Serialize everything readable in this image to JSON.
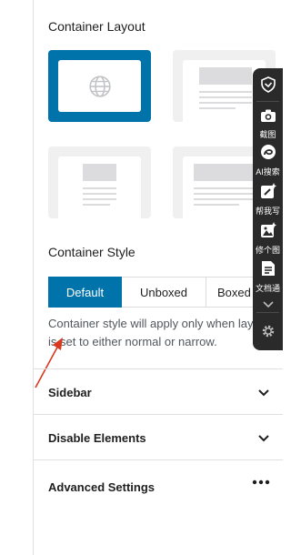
{
  "container_layout": {
    "title": "Container Layout",
    "options": [
      {
        "name": "full-width",
        "selected": true
      },
      {
        "name": "sidebar-right",
        "selected": false
      },
      {
        "name": "narrow",
        "selected": false
      },
      {
        "name": "normal",
        "selected": false
      }
    ]
  },
  "container_style": {
    "title": "Container Style",
    "buttons": [
      "Default",
      "Unboxed",
      "Boxed"
    ],
    "active": "Default",
    "help_line1": "Container style will apply only when lay",
    "help_line2": "is set to either normal or narrow."
  },
  "panels": [
    {
      "label": "Sidebar",
      "icon": "chevron-down-icon"
    },
    {
      "label": "Disable Elements",
      "icon": "chevron-down-icon"
    },
    {
      "label": "Advanced Settings",
      "icon": "more-dots-icon"
    }
  ],
  "toolbar": {
    "items": [
      {
        "icon": "shield-icon",
        "label": ""
      },
      {
        "icon": "camera-icon",
        "label": "截图"
      },
      {
        "icon": "ai-search-icon",
        "label": "AI搜索"
      },
      {
        "icon": "edit-sparkle-icon",
        "label": "帮我写"
      },
      {
        "icon": "image-edit-icon",
        "label": "修个图"
      },
      {
        "icon": "document-icon",
        "label": "文档通"
      },
      {
        "icon": "chevron-down-icon",
        "label": ""
      },
      {
        "icon": "gear-icon",
        "label": ""
      }
    ]
  },
  "colors": {
    "accent": "#0073aa",
    "toolbar_bg": "#2a2a2a",
    "annotation_arrow": "#d9381e"
  }
}
